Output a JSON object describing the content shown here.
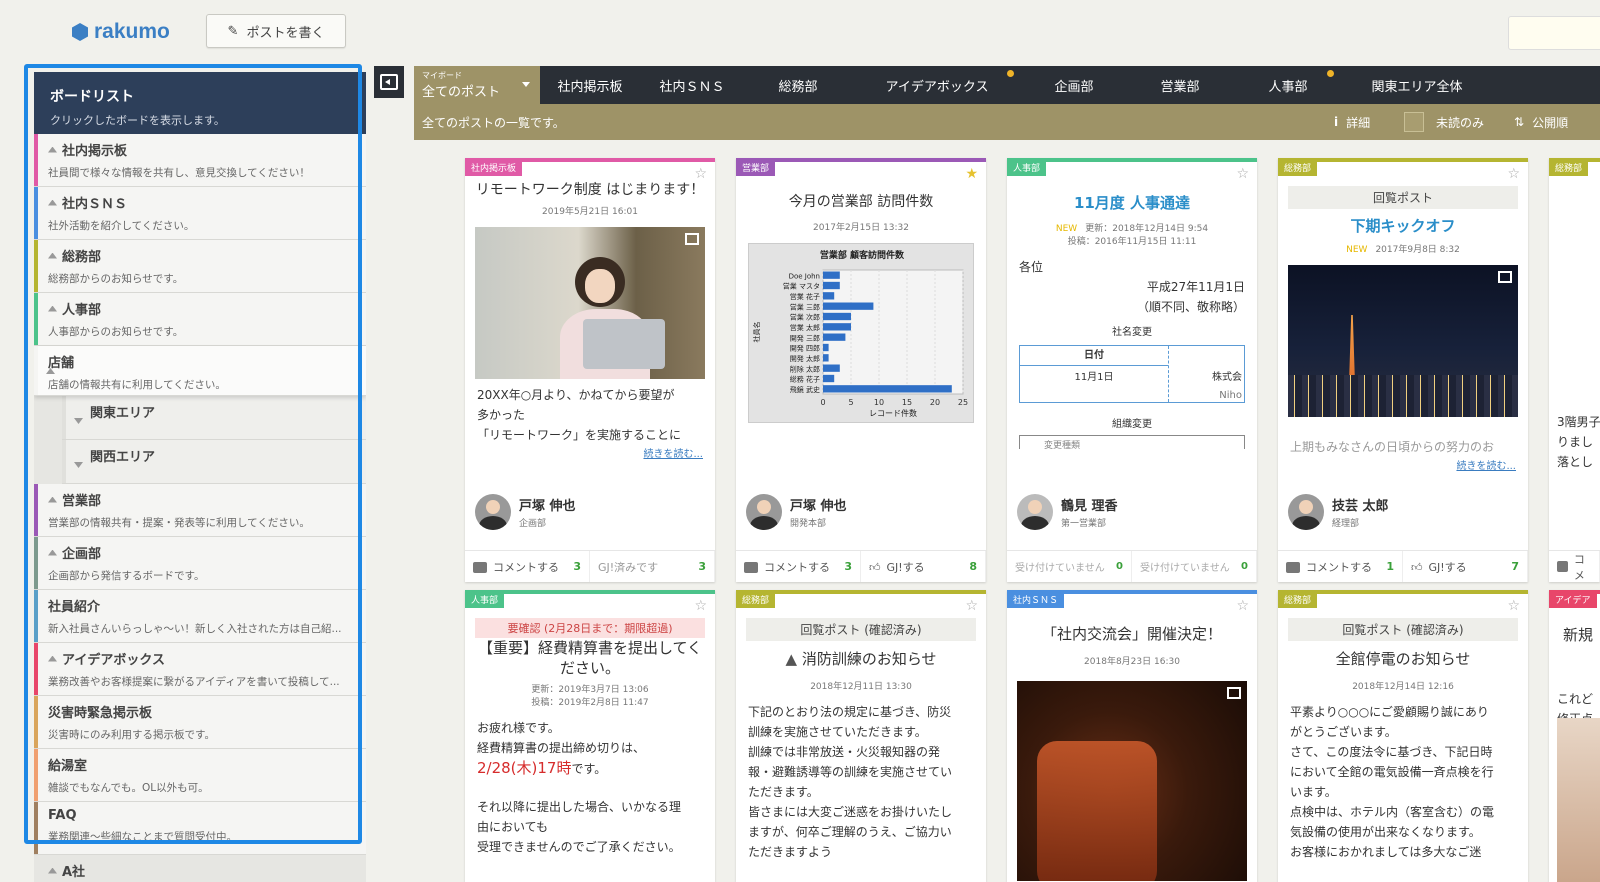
{
  "app": {
    "logo": "rakumo",
    "write_button": "ポストを書く"
  },
  "sidebar": {
    "title": "ボードリスト",
    "subtitle": "クリックしたボードを表示します。",
    "boards": [
      {
        "name": "社内掲示板",
        "desc": "社員間で様々な情報を共有し、意見交換してください！",
        "color": "#e05aa6"
      },
      {
        "name": "社内ＳＮＳ",
        "desc": "社外活動を紹介してください。",
        "color": "#4a8fe0"
      },
      {
        "name": "総務部",
        "desc": "総務部からのお知らせです。",
        "color": "#b5b531"
      },
      {
        "name": "人事部",
        "desc": "人事部からのお知らせです。",
        "color": "#4cc38a"
      },
      {
        "name": "店舗",
        "desc": "店舗の情報共有に利用してください。",
        "color": "#f5f5f3"
      },
      {
        "name": "関東エリア",
        "desc": "",
        "color": "#e0e0dc"
      },
      {
        "name": "関西エリア",
        "desc": "",
        "color": "#e0e0dc"
      },
      {
        "name": "営業部",
        "desc": "営業部の情報共有・提案・発表等に利用してください。",
        "color": "#9b59b6"
      },
      {
        "name": "企画部",
        "desc": "企画部から発信するボードです。",
        "color": "#7d9a8d"
      },
      {
        "name": "社員紹介",
        "desc": "新入社員さんいらっしゃ〜い！新しく入社された方は自己紹...",
        "color": "#5aa0c8"
      },
      {
        "name": "アイデアボックス",
        "desc": "業務改善やお客様提案に繋がるアイディアを書いて投稿して...",
        "color": "#e8466a"
      },
      {
        "name": "災害時緊急掲示板",
        "desc": "災害時にのみ利用する掲示板です。",
        "color": "#d9a55b"
      },
      {
        "name": "給湯室",
        "desc": "雑談でもなんでも。OL以外も可。",
        "color": "#f0a070"
      },
      {
        "name": "FAQ",
        "desc": "業務関連〜些細なことまで質問受付中。",
        "color": "#a08060"
      },
      {
        "name": "A社",
        "desc": "",
        "color": "#e6e6e2"
      }
    ]
  },
  "tabs": {
    "my_small": "マイボード",
    "my": "全てのポスト",
    "items": [
      "社内掲示板",
      "社内ＳＮＳ",
      "総務部",
      "アイデアボックス",
      "企画部",
      "営業部",
      "人事部",
      "関東エリア全体"
    ],
    "dots": [
      false,
      false,
      false,
      true,
      false,
      false,
      true,
      false
    ]
  },
  "infobar": {
    "text": "全てのポストの一覧です。",
    "detail": "詳細",
    "unread": "未読のみ",
    "sort": "公開順"
  },
  "cards": {
    "c1": {
      "tag": "社内掲示板",
      "title": "リモートワーク制度 はじまります！",
      "date": "2019年5月21日 16:01",
      "body": [
        "20XX年○月より、かねてから要望が",
        "多かった",
        "「リモートワーク」を実施することに"
      ],
      "more": "続きを読む...",
      "author": "戸塚 伸也",
      "dept": "企画部",
      "f1": "コメントする",
      "f1n": "3",
      "f2": "GJ!済みです",
      "f2n": "3"
    },
    "c2": {
      "tag": "営業部",
      "title": "今月の営業部 訪問件数",
      "date": "2017年2月15日 13:32",
      "chart_title": "営業部 顧客訪問件数",
      "author": "戸塚 伸也",
      "dept": "開発本部",
      "f1": "コメントする",
      "f1n": "3",
      "f2": "GJ!する",
      "f2n": "8"
    },
    "c3": {
      "tag": "人事部",
      "title": "11月度 人事通達",
      "new": "NEW",
      "updated": "更新：2018年12月14日 9:54",
      "posted": "投稿：2016年11月15日 11:11",
      "body1": "各位",
      "body2": "平成27年11月1日",
      "body3": "（順不同、敬称略）",
      "sec1": "社名変更",
      "th": "日付",
      "td": "11月1日",
      "td2": "株式会",
      "td3": "Niho",
      "sec2": "組織変更",
      "sec3": "変更種類",
      "author": "鶴見 理香",
      "dept": "第一営業部",
      "f1": "受け付けていません",
      "f1n": "0",
      "f2": "受け付けていません",
      "f2n": "0"
    },
    "c4": {
      "tag": "総務部",
      "kairan": "回覧ポスト",
      "title": "下期キックオフ",
      "new": "NEW",
      "date": "2017年9月8日 8:32",
      "body": "上期もみなさんの日頃からの努力のお",
      "more": "続きを読む...",
      "author": "技芸 太郎",
      "dept": "経理部",
      "f1": "コメントする",
      "f1n": "1",
      "f2": "GJ!する",
      "f2n": "7"
    },
    "c5": {
      "tag": "総務部",
      "body": [
        "3階男子",
        "りまし",
        "落とし"
      ],
      "f1": "コメ"
    },
    "c6": {
      "tag": "人事部",
      "urgent": "要確認 (2月28日まで：期限超過)",
      "title": "【重要】経費精算書を提出してください。",
      "updated": "更新：2019年3月7日 13:06",
      "posted": "投稿：2019年2月8日 11:47",
      "body": [
        "お疲れ様です。",
        "経費精算書の提出締め切りは、"
      ],
      "deadline": "2/28(木)17時",
      "deadline_suffix": "です。",
      "body2": [
        "それ以降に提出した場合、いかなる理",
        "由においても",
        "受理できませんのでご了承ください。"
      ]
    },
    "c7": {
      "tag": "総務部",
      "kairan": "回覧ポスト (確認済み)",
      "title": "消防訓練のお知らせ",
      "date": "2018年12月11日 13:30",
      "body": [
        "下記のとおり法の規定に基づき、防災",
        "訓練を実施させていただきます。",
        "訓練では非常放送・火災報知器の発",
        "報・避難誘導等の訓練を実施させてい",
        "ただきます。",
        "皆さまには大変ご迷惑をお掛けいたし",
        "ますが、何卒ご理解のうえ、ご協力い",
        "ただきますよう"
      ]
    },
    "c8": {
      "tag": "社内ＳＮＳ",
      "title": "「社内交流会」開催決定！",
      "date": "2018年8月23日 16:30"
    },
    "c9": {
      "tag": "総務部",
      "kairan": "回覧ポスト (確認済み)",
      "title": "全館停電のお知らせ",
      "date": "2018年12月14日 12:16",
      "body": [
        "平素より○○○にご愛顧賜り誠にあり",
        "がとうございます。",
        "さて、この度法令に基づき、下記日時",
        "において全館の電気設備一斉点検を行",
        "います。",
        "点検中は、ホテル内（客室含む）の電",
        "気設備の使用が出来なくなります。",
        "お客様におかれましては多大なご迷"
      ]
    },
    "c10": {
      "tag": "アイデア",
      "title": "新規",
      "body": [
        "これど",
        "修正点"
      ]
    }
  },
  "colors": {
    "accent": "#1e88e5",
    "nav": "#2a2f36",
    "gold": "#9e9367"
  },
  "chart_data": {
    "type": "bar",
    "title": "営業部 顧客訪問件数",
    "xlabel": "レコード件数",
    "ylabel": "社員名",
    "categories": [
      "Doe John",
      "営業 マスタ",
      "営業 花子",
      "営業 三郎",
      "営業 次郎",
      "営業 太郎",
      "開発 三郎",
      "開発 四郎",
      "開発 太郎",
      "削除 太郎",
      "総務 花子",
      "飛鏡 武史"
    ],
    "values": [
      3,
      3,
      2,
      9,
      5,
      5,
      4,
      1,
      1,
      3,
      2,
      23
    ],
    "xlim": [
      0,
      25
    ],
    "xticks": [
      0,
      5,
      10,
      15,
      20,
      25
    ]
  }
}
